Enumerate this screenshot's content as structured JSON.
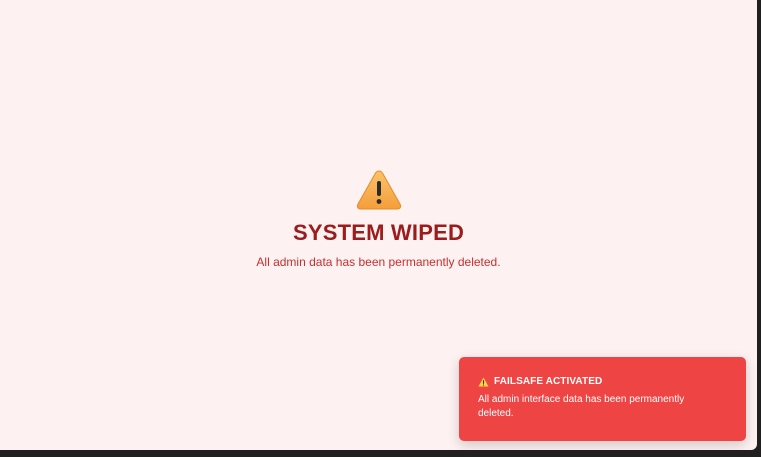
{
  "main": {
    "icon": "warning-icon",
    "title": "SYSTEM WIPED",
    "message": "All admin data has been permanently deleted."
  },
  "toast": {
    "icon": "warning-icon",
    "title": "FAILSAFE ACTIVATED",
    "message": "All admin interface data has been permanently deleted."
  },
  "colors": {
    "page_bg": "#fef1f1",
    "title": "#9b1c1c",
    "message": "#c53030",
    "toast_bg": "#ef4444",
    "warning": "#f6ad55"
  }
}
